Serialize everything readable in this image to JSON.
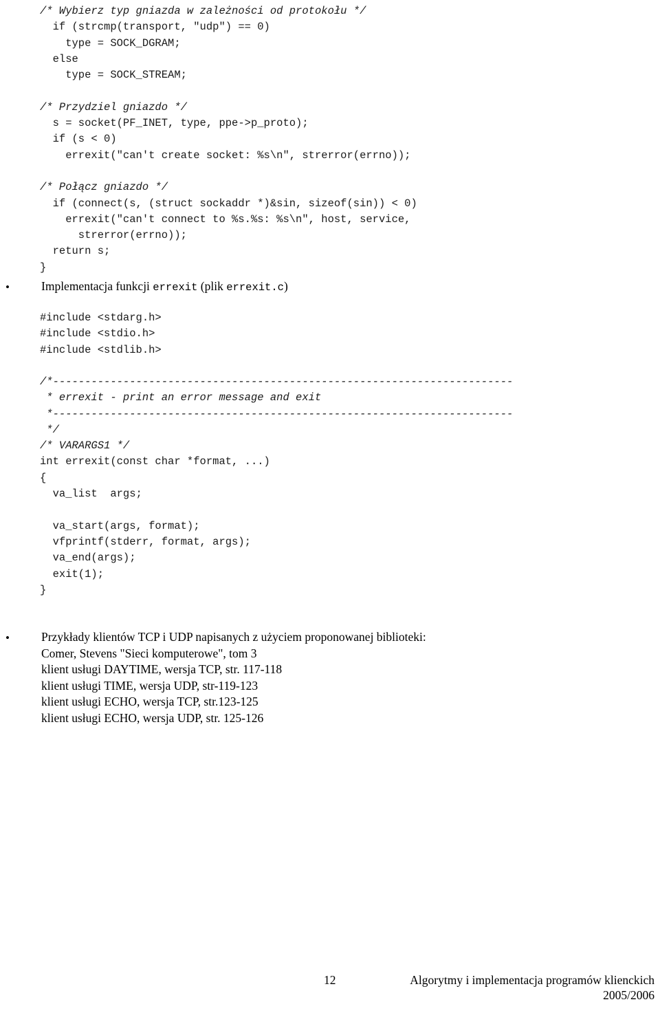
{
  "document": {
    "language": "pl",
    "title": "Algorytmy i implementacja programów klienckich",
    "page_number": "12",
    "year": "2005/2006"
  },
  "code_connect": {
    "lines": [
      "/* Wybierz typ gniazda w zależności od protokołu */",
      "  if (strcmp(transport, \"udp\") == 0)",
      "    type = SOCK_DGRAM;",
      "  else",
      "    type = SOCK_STREAM;",
      "",
      "/* Przydziel gniazdo */",
      "  s = socket(PF_INET, type, ppe->p_proto);",
      "  if (s < 0)",
      "    errexit(\"can't create socket: %s\\n\", strerror(errno));",
      "",
      "/* Połącz gniazdo */",
      "  if (connect(s, (struct sockaddr *)&sin, sizeof(sin)) < 0)",
      "    errexit(\"can't connect to %s.%s: %s\\n\", host, service,",
      "      strerror(errno));",
      "  return s;",
      "}"
    ],
    "comment_line_indices": [
      0,
      6,
      11
    ]
  },
  "bullet_implementacja": {
    "marker": "•",
    "text_before": "Implementacja funkcji ",
    "mono_1": "errexit",
    "text_middle": " (plik ",
    "mono_2": "errexit.c",
    "text_after": ")"
  },
  "code_includes": {
    "lines": [
      "#include <stdarg.h>",
      "#include <stdio.h>",
      "#include <stdlib.h>"
    ]
  },
  "code_errexit": {
    "rule_top": "/*------------------------------------------------------------------------",
    "comment_title": " * errexit - print an error message and exit",
    "rule_bottom": " *------------------------------------------------------------------------",
    "comment_close": " */",
    "varargs": "/* VARARGS1 */",
    "lines": [
      "int errexit(const char *format, ...)",
      "{",
      "  va_list  args;",
      "",
      "  va_start(args, format);",
      "  vfprintf(stderr, format, args);",
      "  va_end(args);",
      "  exit(1);",
      "}"
    ]
  },
  "bullet_przyklady": {
    "marker": "•",
    "lines": [
      "Przykłady klientów TCP i UDP napisanych z użyciem proponowanej biblioteki:",
      "Comer, Stevens \"Sieci komputerowe\", tom 3",
      "klient usługi DAYTIME, wersja TCP, str. 117-118",
      "klient usługi TIME, wersja UDP, str-119-123",
      "klient usługi ECHO, wersja TCP, str.123-125",
      "klient usługi ECHO, wersja UDP, str. 125-126"
    ]
  }
}
